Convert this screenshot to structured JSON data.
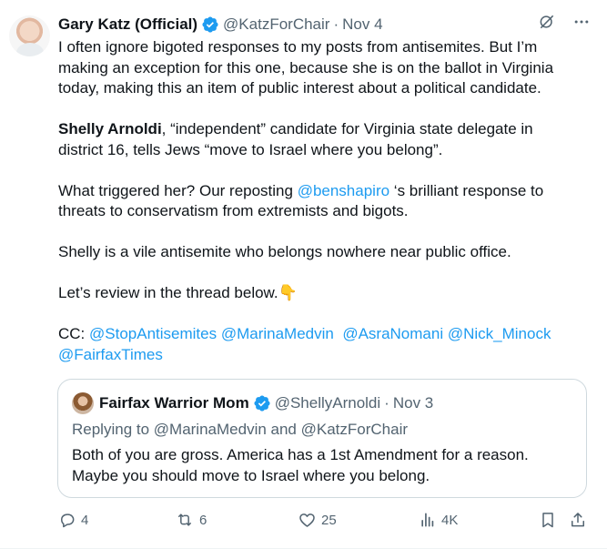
{
  "tweet": {
    "author_name": "Gary Katz (Official)",
    "handle": "@KatzForChair",
    "separator": "·",
    "date": "Nov 4",
    "paragraphs": {
      "p1": "I often ignore bigoted responses to my posts from antisemites. But I’m making an exception for this one, because she is on the ballot in Virginia today, making this an item of public interest about a political candidate.",
      "p2_bold": "Shelly Arnoldi",
      "p2_rest": ", “independent” candidate for Virginia state delegate in district 16,  tells Jews “move to Israel where you belong”.",
      "p3_pre": "What triggered her? Our reposting ",
      "p3_mention": "@benshapiro",
      "p3_post": " ‘s brilliant response to threats to conservatism from extremists and bigots.",
      "p4": "Shelly is a vile antisemite who belongs nowhere near public office.",
      "p5": "Let’s review in the thread below.👇",
      "cc_label": "CC: ",
      "cc_mentions": [
        "@StopAntisemites",
        "@MarinaMedvin",
        "@AsraNomani",
        "@Nick_Minock",
        "@FairfaxTimes"
      ]
    }
  },
  "quote": {
    "author_name": "Fairfax Warrior Mom",
    "handle": "@ShellyArnoldi",
    "separator": "·",
    "date": "Nov 3",
    "replying_to": "Replying to @MarinaMedvin and @KatzForChair",
    "text": "Both of you are gross. America has a 1st Amendment for a reason. Maybe you should move to Israel where you belong."
  },
  "actions": {
    "replies": "4",
    "reposts": "6",
    "likes": "25",
    "views": "4K"
  },
  "icons": {
    "verified": "verified-badge-icon",
    "grok": "grok-icon",
    "more": "more-icon",
    "reply": "reply-icon",
    "repost": "repost-icon",
    "like": "like-icon",
    "views": "views-icon",
    "bookmark": "bookmark-icon",
    "share": "share-icon"
  },
  "colors": {
    "accent": "#1d9bf0",
    "text": "#0f1419",
    "secondary": "#536471",
    "border": "#cfd9de"
  }
}
